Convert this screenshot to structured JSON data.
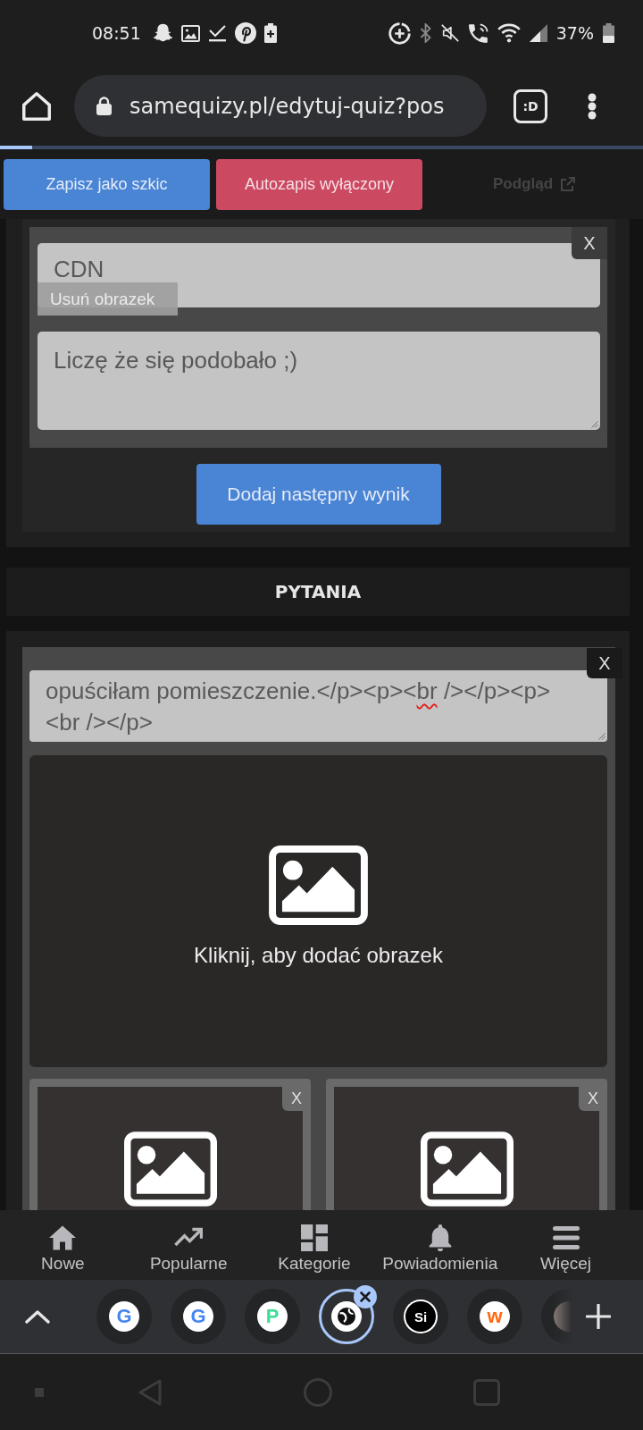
{
  "status_bar": {
    "time": "08:51",
    "battery": "37%"
  },
  "browser": {
    "url": "samequizy.pl/edytuj-quiz?pos",
    "tab_switcher": ":D",
    "load_progress": {
      "level": 0.05
    }
  },
  "toolbar": {
    "buttons": [
      {
        "label": "Zapisz jako szkic",
        "kind": "primary"
      },
      {
        "label": "Autozapis wyłączony",
        "kind": "danger"
      }
    ],
    "preview_link": {
      "label": "Podgląd",
      "disabled": true
    }
  },
  "results": {
    "items": [
      {
        "title": "CDN",
        "image_action": "Usuń obrazek",
        "remove": "X",
        "description": "Liczę że się podobało ;)"
      }
    ],
    "add_button": "Dodaj następny wynik"
  },
  "questions": {
    "heading": "PYTANIA",
    "items": [
      {
        "remove": "X",
        "text": [
          {
            "text": "opuściłam pomieszczenie.</p><p><",
            "misspelled": false
          },
          {
            "text": "br",
            "misspelled": true
          },
          {
            "text": " /></p><p>\n<br /></p>",
            "misspelled": false
          }
        ],
        "image_prompt": "Kliknij, aby dodać obrazek",
        "answers": [
          {
            "remove": "X"
          },
          {
            "remove": "X"
          }
        ]
      }
    ]
  },
  "bottom_nav": [
    {
      "label": "Nowe"
    },
    {
      "label": "Popularne"
    },
    {
      "label": "Kategorie"
    },
    {
      "label": "Powiadomienia"
    },
    {
      "label": "Więcej"
    }
  ],
  "tab_strip": {
    "tabs": [
      {
        "kind": "letter",
        "favicon": "G",
        "color": "#4285f4",
        "selected": false
      },
      {
        "kind": "letter",
        "favicon": "G",
        "color": "#4285f4",
        "selected": false
      },
      {
        "kind": "letter",
        "favicon": "P",
        "color": "#3ddc97",
        "selected": false
      },
      {
        "kind": "globe",
        "selected": true
      },
      {
        "kind": "inverted",
        "favicon": "Si",
        "color": "#000000",
        "selected": false
      },
      {
        "kind": "letter",
        "favicon": "w",
        "color": "#ff6a13",
        "selected": false
      },
      {
        "kind": "partial",
        "selected": false
      }
    ]
  }
}
